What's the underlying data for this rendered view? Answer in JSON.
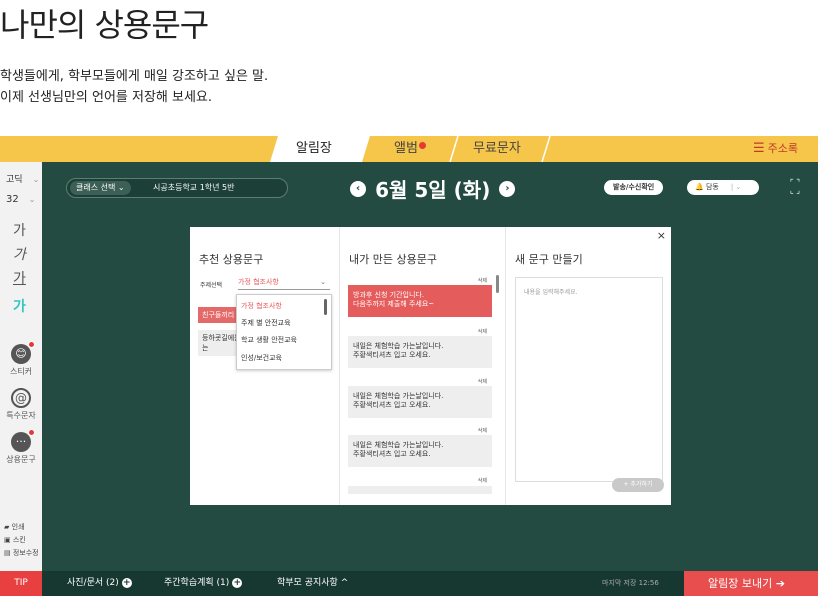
{
  "page": {
    "title": "나만의 상용문구",
    "intro_line1": "학생들에게, 학부모들에게 매일 강조하고 싶은 말.",
    "intro_line2": "이제 선생님만의 언어를 저장해 보세요."
  },
  "tabs": {
    "notice": "알림장",
    "album": "앨범",
    "sms": "무료문자",
    "contacts": "주소록"
  },
  "rail": {
    "font_select": "고딕",
    "size_select": "32",
    "ga": "가",
    "sticker": "스티커",
    "special_char": "특수문자",
    "phrases": "상용문구",
    "print": "인쇄",
    "scan": "스킨",
    "info_edit": "정보수정",
    "sticker_icon": "😊",
    "at_icon": "@",
    "more_icon": "···"
  },
  "board": {
    "class_select_label": "클래스 선택",
    "class_name": "시공초등학교 1학년 5반",
    "date": "6월 5일 (화)",
    "send_confirm": "발송/수신확인",
    "bell_label": "담동"
  },
  "modal": {
    "col1_title": "추천 상용문구",
    "topic_label": "주제선택",
    "topic_selected": "가정 협조사항",
    "dropdown_options": [
      "가정 협조사항",
      "주제 별 안전교육",
      "학교 생활 안전교육",
      "인성/보건교육"
    ],
    "rec_items": [
      "친구들끼리 사이좋게 지내도록",
      "등하굣길에는 차를 조심하고 길을 건널 때는"
    ],
    "col2_title": "내가 만든 상용문구",
    "delete_label": "삭제",
    "my_phrases": [
      {
        "line1": "방과후 신청 기간입니다.",
        "line2": "다음주까지 제출해 주세요~"
      },
      {
        "line1": "내일은 체험학습 가는날입니다.",
        "line2": "주황색티셔츠 입고 오세요."
      },
      {
        "line1": "내일은 체험학습 가는날입니다.",
        "line2": "주황색티셔츠 입고 오세요."
      },
      {
        "line1": "내일은 체험학습 가는날입니다.",
        "line2": "주황색티셔츠 입고 오세요."
      }
    ],
    "col3_title": "새 문구 만들기",
    "new_placeholder": "내용을 입력해주세요.",
    "add_button": "+ 추가하기"
  },
  "footer": {
    "tip": "TIP",
    "photos": "사진/문서 (2)",
    "weekly_plan": "주간학습계획 (1)",
    "parent_notice": "학부모 공지사항",
    "autosave": "마지막 저장 12:56",
    "send": "알림장 보내기"
  },
  "colors": {
    "tab_yellow": "#f6c64a",
    "board_green": "#234b42",
    "accent_red": "#e84e4e",
    "teal": "#2fc7c2"
  }
}
